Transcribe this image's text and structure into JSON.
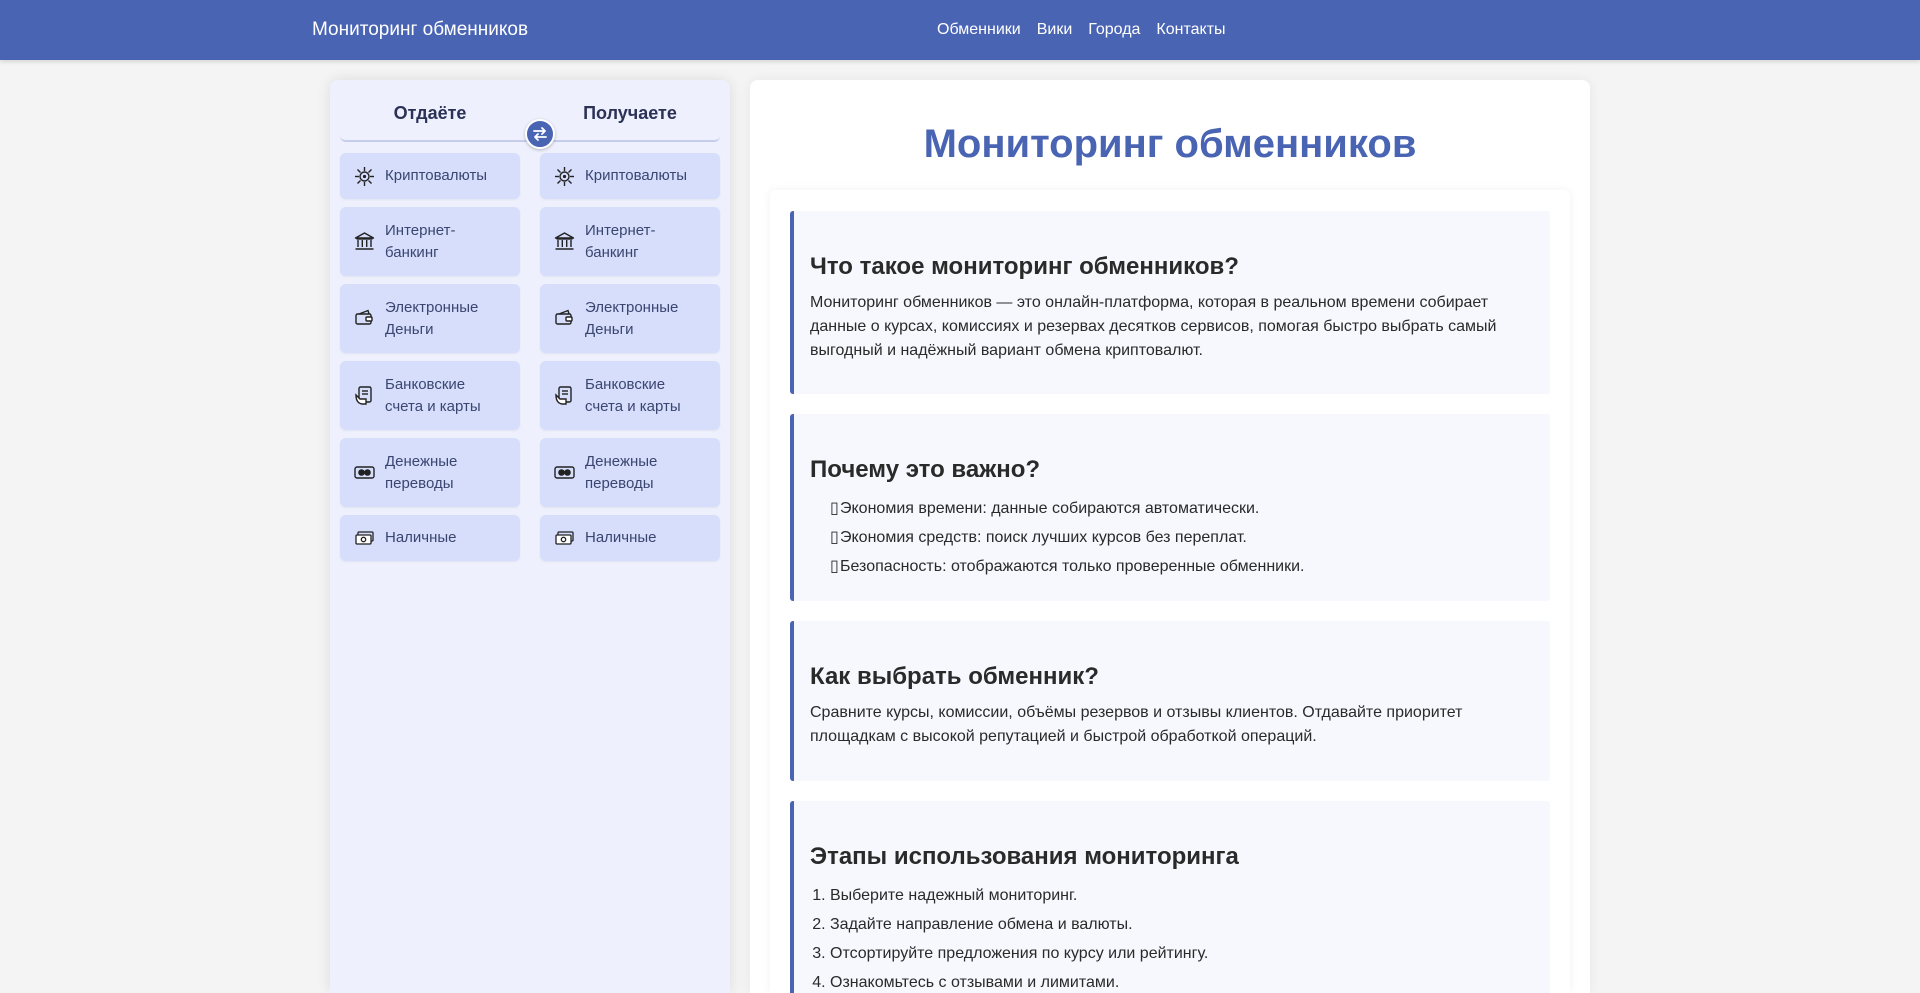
{
  "header": {
    "brand": "Мониторинг обменников",
    "nav": [
      "Обменники",
      "Вики",
      "Города",
      "Контакты"
    ]
  },
  "panel": {
    "give_label": "Отдаёте",
    "get_label": "Получаете",
    "categories": [
      {
        "label": "Криптовалюты",
        "icon": "crypto-icon"
      },
      {
        "label": "Интернет-банкинг",
        "icon": "bank-icon"
      },
      {
        "label": "Электронные Деньги",
        "icon": "wallet-icon"
      },
      {
        "label": "Банковские счета и карты",
        "icon": "bank-card-icon"
      },
      {
        "label": "Денежные переводы",
        "icon": "money-transfer-icon"
      },
      {
        "label": "Наличные",
        "icon": "cash-icon"
      }
    ]
  },
  "main": {
    "title": "Мониторинг обменников",
    "sections": [
      {
        "heading": "Что такое мониторинг обменников?",
        "text": "Мониторинг обменников — это онлайн-платформа, которая в реальном времени собирает данные о курсах, комиссиях и резервах десятков сервисов, помогая быстро выбрать самый выгодный и надёжный вариант обмена криптовалют."
      },
      {
        "heading": "Почему это важно?",
        "items": [
          "Экономия времени: данные собираются автоматически.",
          "Экономия средств: поиск лучших курсов без переплат.",
          "Безопасность: отображаются только проверенные обменники."
        ]
      },
      {
        "heading": "Как выбрать обменник?",
        "text": "Сравните курсы, комиссии, объёмы резервов и отзывы клиентов. Отдавайте приоритет площадкам с высокой репутацией и быстрой обработкой операций."
      },
      {
        "heading": "Этапы использования мониторинга",
        "steps": [
          "Выберите надежный мониторинг.",
          "Задайте направление обмена и валюты.",
          "Отсортируйте предложения по курсу или рейтингу.",
          "Ознакомьтесь с отзывами и лимитами."
        ]
      }
    ]
  },
  "colors": {
    "accent": "#4a64b4",
    "panel_bg": "#eef1fd",
    "category_bg": "#d6defc"
  }
}
